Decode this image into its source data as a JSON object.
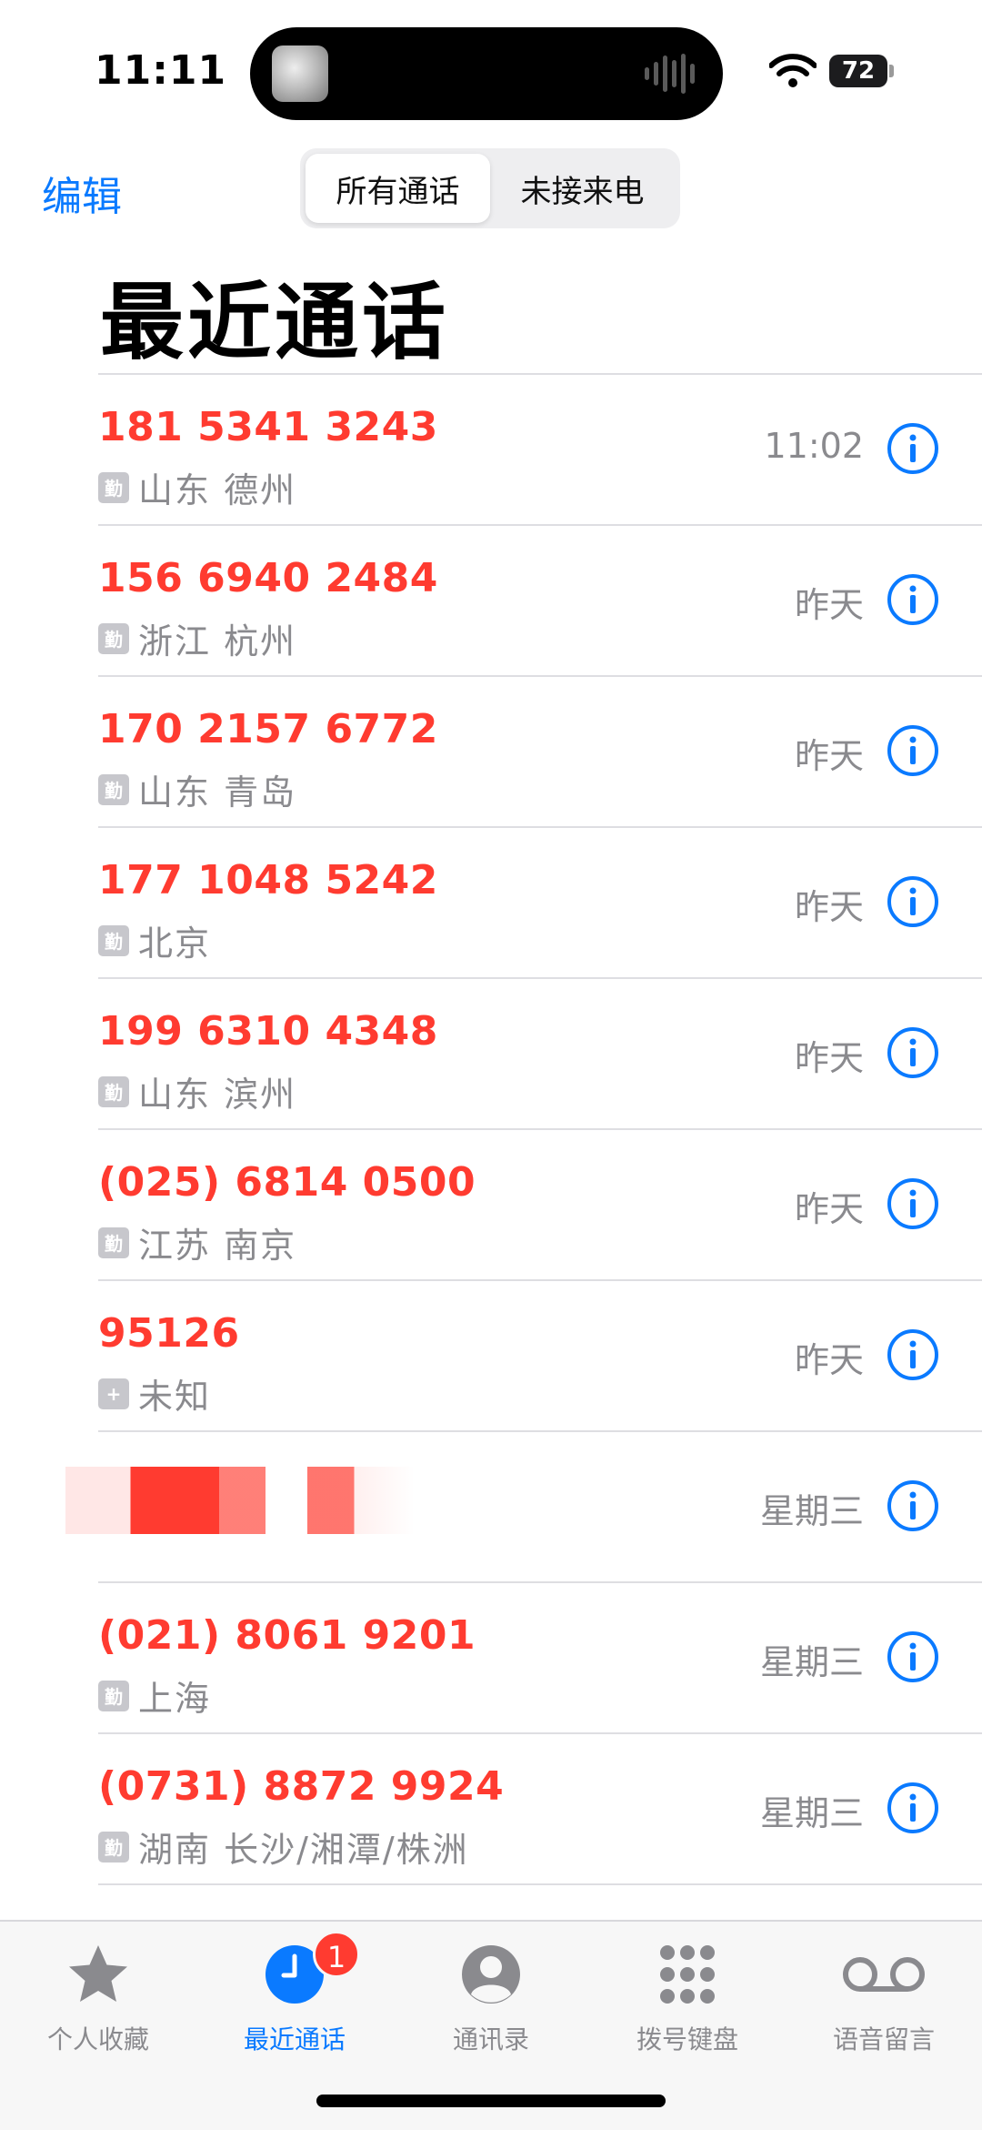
{
  "status_bar": {
    "time": "11:11",
    "battery": "72"
  },
  "header": {
    "edit_label": "编辑",
    "segments": [
      "所有通话",
      "未接来电"
    ],
    "title": "最近通话"
  },
  "calls": [
    {
      "number": "181 5341 3243",
      "tag": "勤",
      "location": "山东 德州",
      "time": "11:02"
    },
    {
      "number": "156 6940 2484",
      "tag": "勤",
      "location": "浙江 杭州",
      "time": "昨天"
    },
    {
      "number": "170 2157 6772",
      "tag": "勤",
      "location": "山东 青岛",
      "time": "昨天"
    },
    {
      "number": "177 1048 5242",
      "tag": "勤",
      "location": "北京",
      "time": "昨天"
    },
    {
      "number": "199 6310 4348",
      "tag": "勤",
      "location": "山东 滨州",
      "time": "昨天"
    },
    {
      "number": "(025) 6814 0500",
      "tag": "勤",
      "location": "江苏 南京",
      "time": "昨天"
    },
    {
      "number": "95126",
      "tag": "+",
      "location": "未知",
      "time": "昨天"
    },
    {
      "time": "星期三"
    },
    {
      "number": "(021) 8061 9201",
      "tag": "勤",
      "location": "上海",
      "time": "星期三"
    },
    {
      "number": "(0731) 8872 9924",
      "tag": "勤",
      "location": "湖南 长沙/湘潭/株洲",
      "time": "星期三"
    }
  ],
  "tab_bar": {
    "tabs": [
      {
        "label": "个人收藏",
        "icon": "star-icon"
      },
      {
        "label": "最近通话",
        "icon": "clock-icon"
      },
      {
        "label": "通讯录",
        "icon": "person-circle-icon"
      },
      {
        "label": "拨号键盘",
        "icon": "keypad-icon"
      },
      {
        "label": "语音留言",
        "icon": "voicemail-icon"
      }
    ],
    "recents_badge": "1"
  },
  "colors": {
    "accent": "#0a7aff",
    "missed": "#ff3b30",
    "secondary_text": "#8a8a8e"
  }
}
